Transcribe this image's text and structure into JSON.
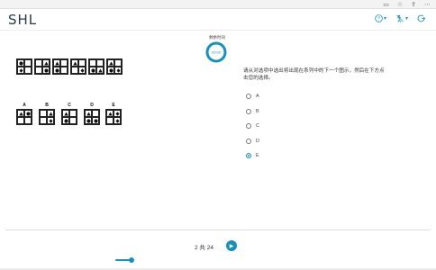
{
  "header": {
    "logo": "SHL",
    "help_icon": "question-circle-icon",
    "accessibility_icon": "accessibility-icon",
    "exit_icon": "exit-icon"
  },
  "timer": {
    "label": "剩余时间",
    "value": "00:00",
    "accent": "#1a8fb8"
  },
  "question": {
    "text": "请从对选项中选出将出现在系列中的下一个图示，然后在下方点击您的选择。"
  },
  "options": [
    {
      "label": "A",
      "selected": false
    },
    {
      "label": "B",
      "selected": false
    },
    {
      "label": "C",
      "selected": false
    },
    {
      "label": "D",
      "selected": false
    },
    {
      "label": "E",
      "selected": true
    }
  ],
  "answer_letters": [
    "A",
    "B",
    "C",
    "D",
    "E"
  ],
  "pager": {
    "text": "2 共 24"
  },
  "progress": {
    "fraction": 0.0833
  },
  "colors": {
    "accent": "#1a8fb8"
  }
}
